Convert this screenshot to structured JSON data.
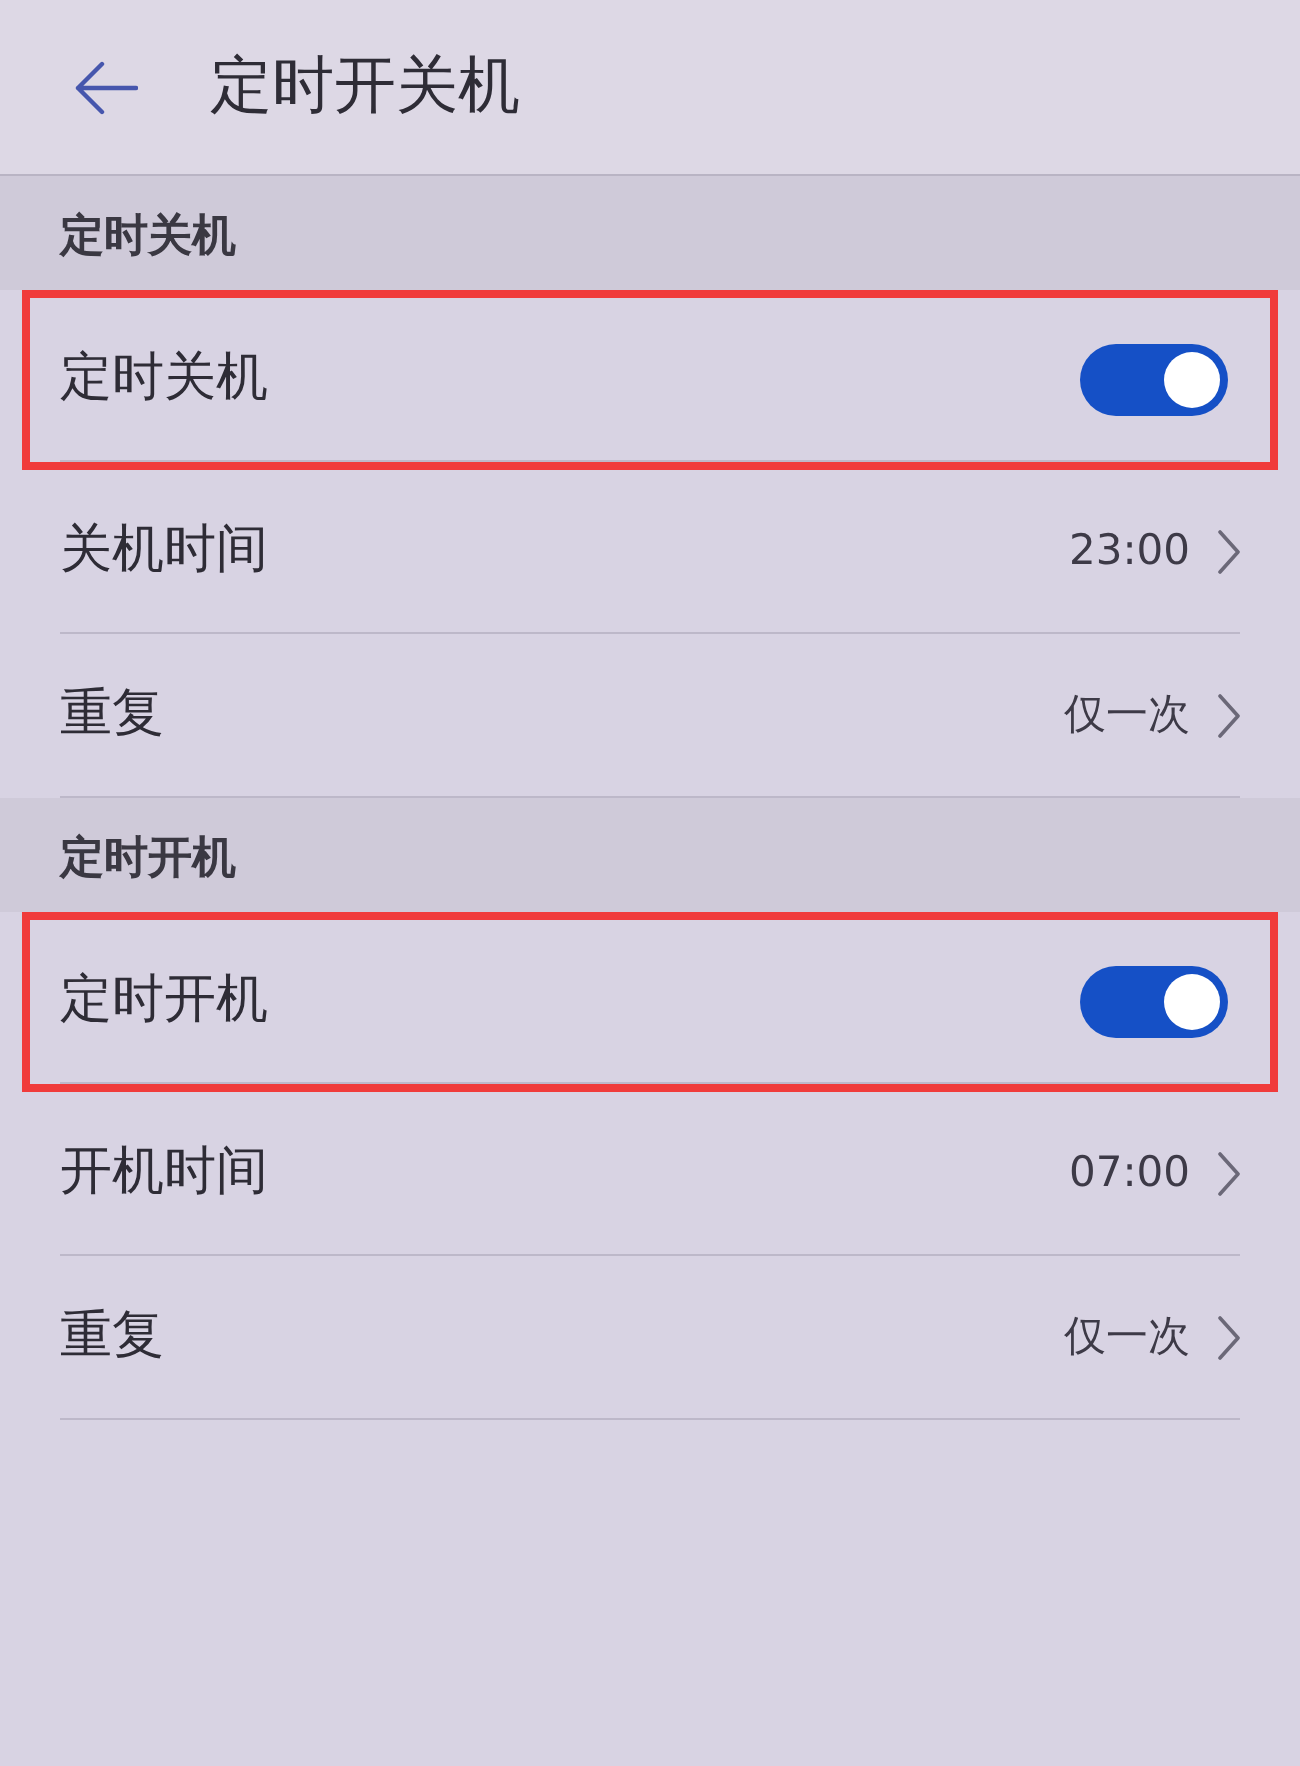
{
  "header": {
    "title": "定时开关机"
  },
  "sections": [
    {
      "title": "定时关机",
      "rows": [
        {
          "kind": "toggle",
          "label": "定时关机",
          "on": true,
          "highlighted": true
        },
        {
          "kind": "link",
          "label": "关机时间",
          "value": "23:00",
          "highlighted": false
        },
        {
          "kind": "link",
          "label": "重复",
          "value": "仅一次",
          "highlighted": false
        }
      ]
    },
    {
      "title": "定时开机",
      "rows": [
        {
          "kind": "toggle",
          "label": "定时开机",
          "on": true,
          "highlighted": true
        },
        {
          "kind": "link",
          "label": "开机时间",
          "value": "07:00",
          "highlighted": false
        },
        {
          "kind": "link",
          "label": "重复",
          "value": "仅一次",
          "highlighted": false
        }
      ]
    }
  ]
}
